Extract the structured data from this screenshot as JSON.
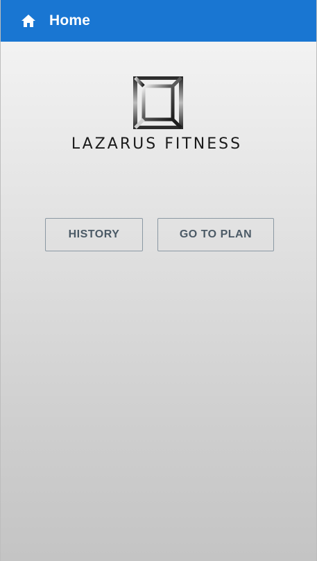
{
  "appbar": {
    "title": "Home",
    "icon": "home-icon",
    "color": "#1976d2"
  },
  "logo": {
    "text": "LAZARUS FITNESS"
  },
  "actions": {
    "history_label": "HISTORY",
    "plan_label": "GO TO PLAN"
  }
}
